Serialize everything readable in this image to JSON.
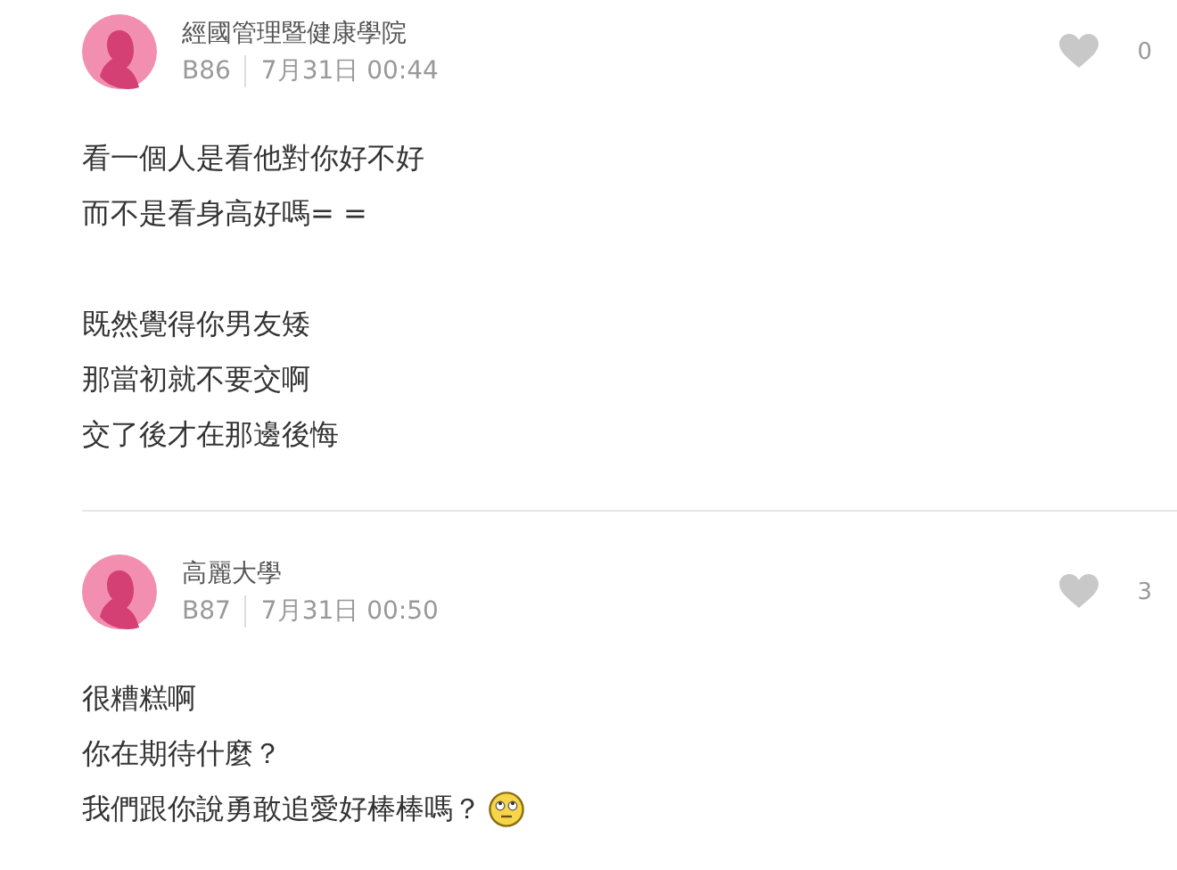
{
  "comments": [
    {
      "author": "經國管理暨健康學院",
      "floor": "B86",
      "time": "7月31日 00:44",
      "likes": "0",
      "paragraphs": [
        [
          {
            "kind": "text",
            "text": "看一個人是看他對你好不好"
          },
          {
            "kind": "text",
            "text": "而不是看身高好嗎= ="
          }
        ],
        [
          {
            "kind": "text",
            "text": "既然覺得你男友矮"
          },
          {
            "kind": "text",
            "text": "那當初就不要交啊"
          },
          {
            "kind": "text",
            "text": "交了後才在那邊後悔"
          }
        ]
      ]
    },
    {
      "author": "高麗大學",
      "floor": "B87",
      "time": "7月31日 00:50",
      "likes": "3",
      "paragraphs": [
        [
          {
            "kind": "text",
            "text": "很糟糕啊"
          },
          {
            "kind": "text",
            "text": "你在期待什麼？"
          },
          {
            "kind": "emoji",
            "text": "我們跟你說勇敢追愛好棒棒嗎？"
          }
        ]
      ]
    }
  ]
}
